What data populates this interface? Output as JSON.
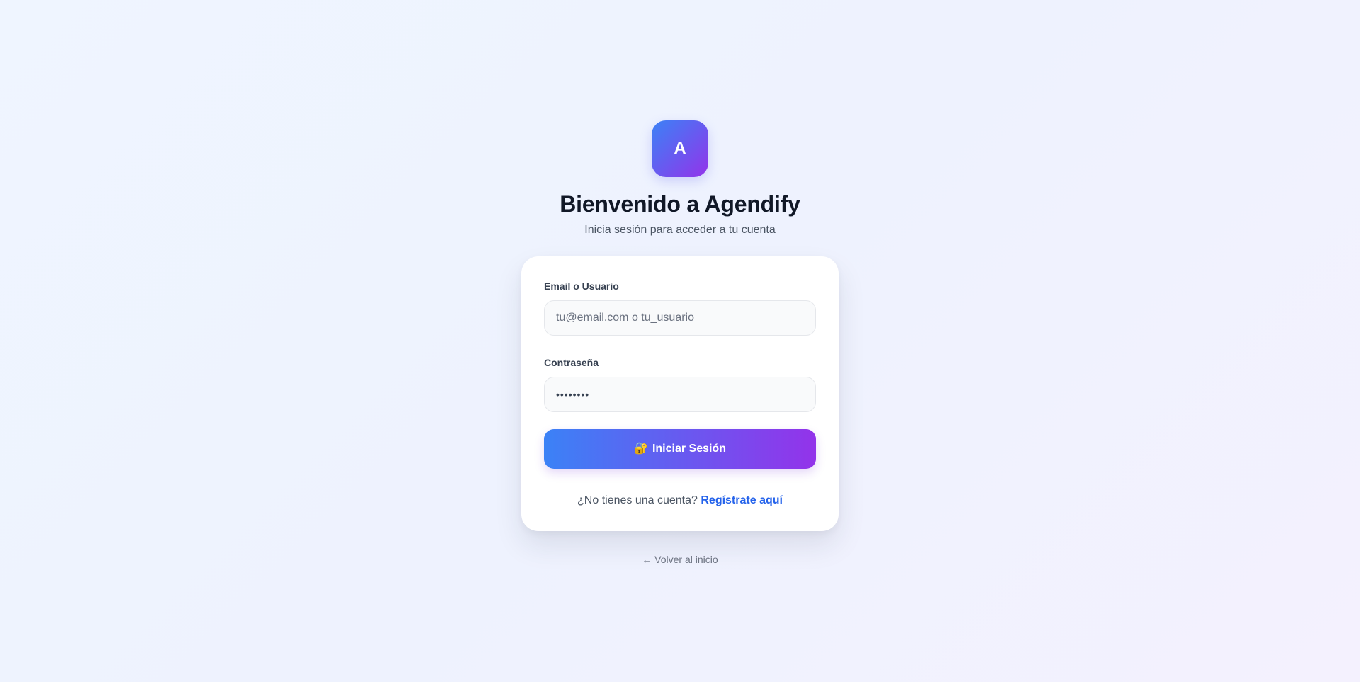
{
  "brand": {
    "logo_letter": "A",
    "title": "Bienvenido a Agendify",
    "subtitle": "Inicia sesión para acceder a tu cuenta"
  },
  "form": {
    "email_label": "Email o Usuario",
    "email_placeholder": "tu@email.com o tu_usuario",
    "email_value": "",
    "password_label": "Contraseña",
    "password_value": "••••••••",
    "submit_icon": "🔐",
    "submit_label": "Iniciar Sesión"
  },
  "signup": {
    "prompt": "¿No tienes una cuenta?",
    "link_label": "Regístrate aquí"
  },
  "back_link": "← Volver al inicio",
  "colors": {
    "gradient_start": "#3b82f6",
    "gradient_end": "#9333ea",
    "link": "#2563eb"
  }
}
